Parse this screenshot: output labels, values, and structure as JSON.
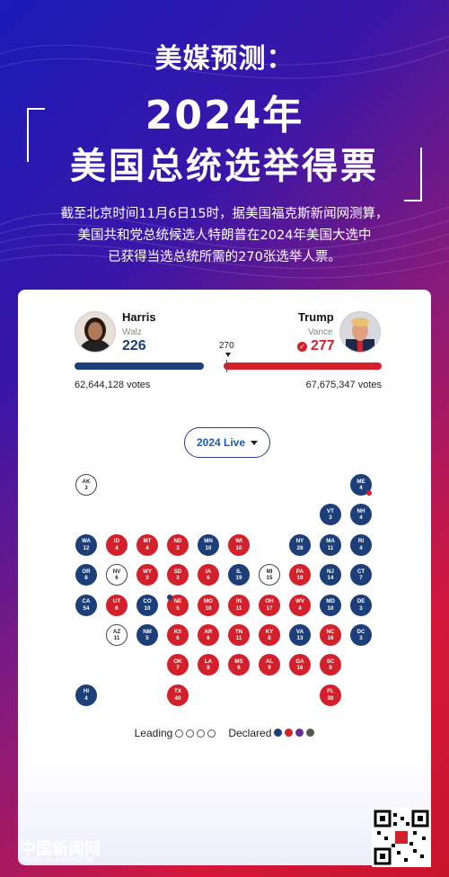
{
  "header": {
    "pre_title": "美媒预测：",
    "year_title": "2024年",
    "main_title": "美国总统选举得票",
    "description_lines": [
      "截至北京时间11月6日15时，据美国福克斯新闻网测算，",
      "美国共和党总统候选人特朗普在2024年美国大选中",
      "已获得当选总统所需的270张选举人票。"
    ]
  },
  "tracker": {
    "threshold": "270",
    "dem": {
      "name": "Harris",
      "vp": "Walz",
      "ev": "226",
      "votes": "62,644,128 votes",
      "color": "#1c3f7a",
      "ev_fraction": 0.42
    },
    "rep": {
      "name": "Trump",
      "vp": "Vance",
      "ev": "277",
      "votes": "67,675,347 votes",
      "color": "#d3202a",
      "ev_fraction": 0.515
    },
    "live_label": "2024 Live"
  },
  "states": [
    {
      "abbr": "AK",
      "ev": "3",
      "party": "U",
      "col": 0,
      "row": 0
    },
    {
      "abbr": "ME",
      "ev": "4",
      "party": "D",
      "col": 9,
      "row": 0,
      "split": true
    },
    {
      "abbr": "VT",
      "ev": "3",
      "party": "D",
      "col": 8,
      "row": 1
    },
    {
      "abbr": "NH",
      "ev": "4",
      "party": "D",
      "col": 9,
      "row": 1
    },
    {
      "abbr": "WA",
      "ev": "12",
      "party": "D",
      "col": 0,
      "row": 2
    },
    {
      "abbr": "ID",
      "ev": "4",
      "party": "R",
      "col": 1,
      "row": 2
    },
    {
      "abbr": "MT",
      "ev": "4",
      "party": "R",
      "col": 2,
      "row": 2
    },
    {
      "abbr": "ND",
      "ev": "3",
      "party": "R",
      "col": 3,
      "row": 2
    },
    {
      "abbr": "MN",
      "ev": "10",
      "party": "D",
      "col": 4,
      "row": 2
    },
    {
      "abbr": "WI",
      "ev": "10",
      "party": "R",
      "col": 5,
      "row": 2
    },
    {
      "abbr": "NY",
      "ev": "28",
      "party": "D",
      "col": 7,
      "row": 2
    },
    {
      "abbr": "MA",
      "ev": "11",
      "party": "D",
      "col": 8,
      "row": 2
    },
    {
      "abbr": "RI",
      "ev": "4",
      "party": "D",
      "col": 9,
      "row": 2
    },
    {
      "abbr": "OR",
      "ev": "8",
      "party": "D",
      "col": 0,
      "row": 3
    },
    {
      "abbr": "NV",
      "ev": "6",
      "party": "U",
      "col": 1,
      "row": 3
    },
    {
      "abbr": "WY",
      "ev": "3",
      "party": "R",
      "col": 2,
      "row": 3
    },
    {
      "abbr": "SD",
      "ev": "3",
      "party": "R",
      "col": 3,
      "row": 3
    },
    {
      "abbr": "IA",
      "ev": "6",
      "party": "R",
      "col": 4,
      "row": 3
    },
    {
      "abbr": "IL",
      "ev": "19",
      "party": "D",
      "col": 5,
      "row": 3
    },
    {
      "abbr": "MI",
      "ev": "15",
      "party": "U",
      "col": 6,
      "row": 3
    },
    {
      "abbr": "PA",
      "ev": "19",
      "party": "R",
      "col": 7,
      "row": 3
    },
    {
      "abbr": "NJ",
      "ev": "14",
      "party": "D",
      "col": 8,
      "row": 3
    },
    {
      "abbr": "CT",
      "ev": "7",
      "party": "D",
      "col": 9,
      "row": 3
    },
    {
      "abbr": "CA",
      "ev": "54",
      "party": "D",
      "col": 0,
      "row": 4
    },
    {
      "abbr": "UT",
      "ev": "6",
      "party": "R",
      "col": 1,
      "row": 4
    },
    {
      "abbr": "CO",
      "ev": "10",
      "party": "D",
      "col": 2,
      "row": 4
    },
    {
      "abbr": "NE",
      "ev": "5",
      "party": "R",
      "col": 3,
      "row": 4,
      "split": true
    },
    {
      "abbr": "MO",
      "ev": "10",
      "party": "R",
      "col": 4,
      "row": 4
    },
    {
      "abbr": "IN",
      "ev": "11",
      "party": "R",
      "col": 5,
      "row": 4
    },
    {
      "abbr": "OH",
      "ev": "17",
      "party": "R",
      "col": 6,
      "row": 4
    },
    {
      "abbr": "WV",
      "ev": "4",
      "party": "R",
      "col": 7,
      "row": 4
    },
    {
      "abbr": "MD",
      "ev": "10",
      "party": "D",
      "col": 8,
      "row": 4
    },
    {
      "abbr": "DE",
      "ev": "3",
      "party": "D",
      "col": 9,
      "row": 4
    },
    {
      "abbr": "AZ",
      "ev": "11",
      "party": "U",
      "col": 1,
      "row": 5
    },
    {
      "abbr": "NM",
      "ev": "5",
      "party": "D",
      "col": 2,
      "row": 5
    },
    {
      "abbr": "KS",
      "ev": "6",
      "party": "R",
      "col": 3,
      "row": 5
    },
    {
      "abbr": "AR",
      "ev": "6",
      "party": "R",
      "col": 4,
      "row": 5
    },
    {
      "abbr": "TN",
      "ev": "11",
      "party": "R",
      "col": 5,
      "row": 5
    },
    {
      "abbr": "KY",
      "ev": "8",
      "party": "R",
      "col": 6,
      "row": 5
    },
    {
      "abbr": "VA",
      "ev": "13",
      "party": "D",
      "col": 7,
      "row": 5
    },
    {
      "abbr": "NC",
      "ev": "16",
      "party": "R",
      "col": 8,
      "row": 5
    },
    {
      "abbr": "DC",
      "ev": "3",
      "party": "D",
      "col": 9,
      "row": 5
    },
    {
      "abbr": "OK",
      "ev": "7",
      "party": "R",
      "col": 3,
      "row": 6
    },
    {
      "abbr": "LA",
      "ev": "8",
      "party": "R",
      "col": 4,
      "row": 6
    },
    {
      "abbr": "MS",
      "ev": "6",
      "party": "R",
      "col": 5,
      "row": 6
    },
    {
      "abbr": "AL",
      "ev": "9",
      "party": "R",
      "col": 6,
      "row": 6
    },
    {
      "abbr": "GA",
      "ev": "16",
      "party": "R",
      "col": 7,
      "row": 6
    },
    {
      "abbr": "SC",
      "ev": "9",
      "party": "R",
      "col": 8,
      "row": 6
    },
    {
      "abbr": "HI",
      "ev": "4",
      "party": "D",
      "col": 0,
      "row": 7
    },
    {
      "abbr": "TX",
      "ev": "40",
      "party": "R",
      "col": 3,
      "row": 7
    },
    {
      "abbr": "FL",
      "ev": "30",
      "party": "R",
      "col": 8,
      "row": 7
    }
  ],
  "legend": {
    "leading_label": "Leading",
    "declared_label": "Declared",
    "declared_colors": [
      "#1c3f7a",
      "#d3202a",
      "#6a2a9a",
      "#555555"
    ]
  },
  "footer": {
    "logo_text": "中国新闻网",
    "url": "WWW.CHINANEWS.COM"
  }
}
